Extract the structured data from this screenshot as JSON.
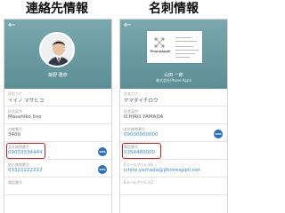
{
  "titles": {
    "left": "連絡先情報",
    "right": "名刺情報"
  },
  "left_panel": {
    "back_icon": "arrow-left-icon",
    "header": {
      "name": "飯野 雅彦",
      "subtitle": ""
    },
    "fields": [
      {
        "label": "氏名カナ",
        "value": "イイノ マサヒコ",
        "link": false,
        "sms": false
      },
      {
        "label": "氏名英字",
        "value": "Masahiko Iino",
        "link": false,
        "sms": false
      },
      {
        "label": "内線番号",
        "value": "3400",
        "link": false,
        "sms": false
      },
      {
        "label": "会社携帯番号",
        "value": "09033334444",
        "link": true,
        "sms": true
      },
      {
        "label": "個人携帯番号",
        "value": "03322222222",
        "link": true,
        "sms": true
      },
      {
        "label": "電話番号",
        "value": "",
        "link": false,
        "sms": false
      }
    ],
    "highlighted_field_index": 3
  },
  "right_panel": {
    "back_icon": "arrow-left-icon",
    "card": {
      "logo_text": "PhoneAppli",
      "logo_icon": "phoneappli-logo-icon"
    },
    "header": {
      "name": "山田 一郎",
      "subtitle": "株式会社Phone Appli"
    },
    "fields": [
      {
        "label": "氏名カナ",
        "value": "ヤマダイチロウ",
        "link": false,
        "sms": false
      },
      {
        "label": "氏名英字",
        "value": "ICHIRO YAMADA",
        "link": false,
        "sms": false
      },
      {
        "label": "会社携帯番号",
        "value": "09000000000",
        "link": true,
        "sms": true
      },
      {
        "label": "電話番号",
        "value": "0354480000",
        "link": true,
        "sms": false
      },
      {
        "label": "Eメールアドレス1",
        "value": "ichiro.yamada@phoneappli.net",
        "link": true,
        "sms": false
      },
      {
        "label": "Eメールアドレス2",
        "value": "",
        "link": false,
        "sms": false
      }
    ],
    "highlighted_field_index": 3
  },
  "sms_button_label": "SMS",
  "colors": {
    "header_teal": "#6f9fa6",
    "link_blue": "#3a8ed6",
    "sms_blue": "#2d6fb6",
    "highlight_red": "#c81e2a"
  }
}
